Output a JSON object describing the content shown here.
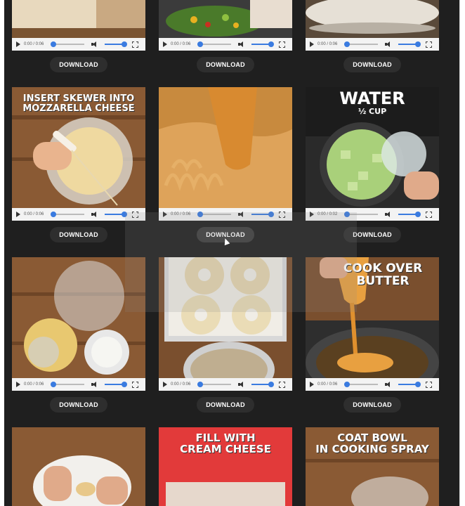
{
  "videos": [
    {
      "time": "0:00 / 0:06",
      "download_label": "DOWNLOAD",
      "caption": ""
    },
    {
      "time": "0:00 / 0:06",
      "download_label": "DOWNLOAD",
      "caption": ""
    },
    {
      "time": "0:00 / 0:06",
      "download_label": "DOWNLOAD",
      "caption": ""
    },
    {
      "time": "0:00 / 0:06",
      "download_label": "DOWNLOAD",
      "caption_line1": "INSERT SKEWER INTO",
      "caption_line2": "MOZZARELLA CHEESE"
    },
    {
      "time": "0:00 / 0:06",
      "download_label": "DOWNLOAD",
      "caption": ""
    },
    {
      "time": "0:00 / 0:02",
      "download_label": "DOWNLOAD",
      "caption_line1": "WATER",
      "caption_line2": "½ CUP"
    },
    {
      "time": "0:00 / 0:06",
      "download_label": "DOWNLOAD",
      "caption": ""
    },
    {
      "time": "0:00 / 0:06",
      "download_label": "DOWNLOAD",
      "caption": ""
    },
    {
      "time": "0:00 / 0:06",
      "download_label": "DOWNLOAD",
      "caption_line1": "COOK OVER",
      "caption_line2": "BUTTER"
    },
    {
      "caption_line1": ""
    },
    {
      "caption_line1": "FILL WITH",
      "caption_line2": "CREAM CHEESE"
    },
    {
      "caption_line1": "COAT BOWL",
      "caption_line2": "IN COOKING SPRAY"
    }
  ],
  "colors": {
    "background": "#1f1f1f",
    "accent": "#3a7be0",
    "button": "#2e2e2e"
  }
}
